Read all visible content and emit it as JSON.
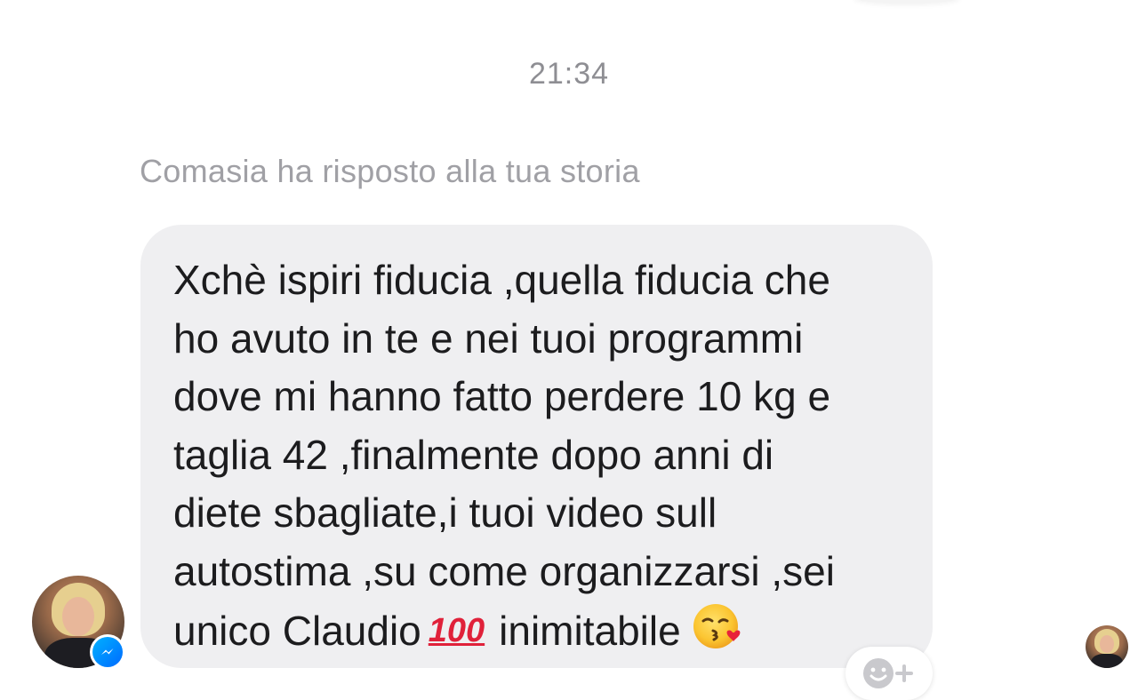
{
  "conversation": {
    "timestamp": "21:34",
    "reply_context": "Comasia ha risposto alla tua storia"
  },
  "message": {
    "lines": [
      "Xchè ispiri fiducia ,quella fiducia che",
      "ho avuto in te e nei tuoi programmi",
      "dove mi hanno fatto perdere 10 kg e",
      "taglia 42 ,finalmente dopo anni di",
      "diete sbagliate,i tuoi video sull",
      "autostima ,su come organizzarsi ,sei"
    ],
    "last_line_start": "unico Claudio",
    "hundred_emoji": "100",
    "last_line_end": "inimitabile",
    "kiss_emoji": "kiss-emoji"
  },
  "icons": {
    "messenger_badge": "messenger-icon",
    "react": "add-reaction-icon"
  },
  "colors": {
    "bubble": "#efeff1",
    "text": "#1c1c1e",
    "meta_text": "#a0a0a5",
    "messenger_blue": "#0084ff"
  }
}
